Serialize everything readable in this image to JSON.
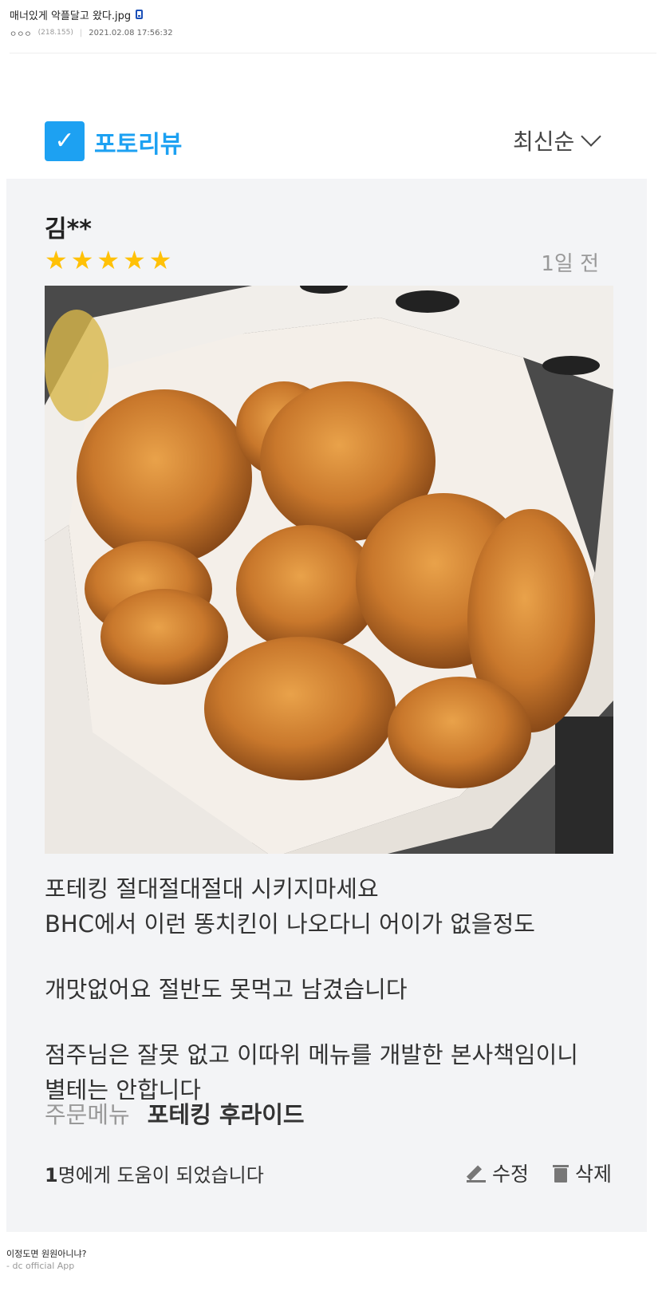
{
  "post": {
    "title": "매너있게 악플달고 왔다.jpg",
    "author": "ㅇㅇㅇ",
    "ip": "(218.155)",
    "separator": "|",
    "datetime": "2021.02.08 17:56:32"
  },
  "review_header": {
    "label": "포토리뷰",
    "sort": "최신순"
  },
  "review": {
    "reviewer": "김**",
    "rating": 5,
    "stars": [
      "★",
      "★",
      "★",
      "★",
      "★"
    ],
    "time_ago": "1일 전",
    "paragraphs": [
      "포테킹 절대절대절대 시키지마세요\nBHC에서 이런 똥치킨이 나오다니 어이가 없을정도",
      "개맛없어요 절반도 못먹고 남겼습니다",
      "점주님은 잘못 없고 이따위 메뉴를 개발한 본사책임이니\n별테는 안합니다"
    ],
    "order_label": "주문메뉴",
    "order_value": "포테킹 후라이드",
    "helpful_count": "1",
    "helpful_suffix": "명에게 도움이 되었습니다",
    "edit_label": "수정",
    "delete_label": "삭제"
  },
  "caption": "이정도면 원원아니냐?",
  "app_sign": "- dc official App",
  "colors": {
    "accent": "#1da1f2",
    "star": "#ffc107",
    "card_bg": "#f3f4f6"
  }
}
